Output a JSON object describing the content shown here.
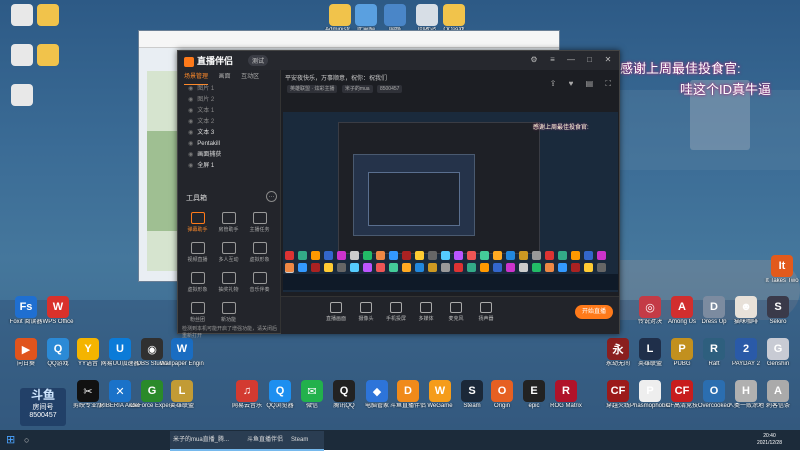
{
  "overlay": {
    "line1": "感谢上周最佳投食官:",
    "line2": "哇这个ID真牛逼"
  },
  "desktop_top_icons": [
    "Administr...",
    "此电脑",
    "网络",
    "回收站",
    "QQ游戏"
  ],
  "desktop_left_icons": [
    {
      "label": "Foxit 阅读器",
      "color": "#1f6fd1",
      "glyph": "Fs"
    },
    {
      "label": "WPS Office",
      "color": "#d9312b",
      "glyph": "W"
    },
    {
      "label": "向日葵",
      "color": "#e0541d",
      "glyph": "▶"
    },
    {
      "label": "QQ游戏",
      "color": "#2b8ad6",
      "glyph": "Q"
    },
    {
      "label": "YY语音",
      "color": "#f4b400",
      "glyph": "Y"
    },
    {
      "label": "网易UU加速器",
      "color": "#0b7bd8",
      "glyph": "U"
    },
    {
      "label": "OBS Studio",
      "color": "#303030",
      "glyph": "◉"
    },
    {
      "label": "Wallpaper Engine",
      "color": "#1a6dc2",
      "glyph": "W"
    }
  ],
  "desktop_bottom_icons": [
    {
      "label": "剪映专业版",
      "color": "#111111",
      "glyph": "✂"
    },
    {
      "label": "RIBERIA Audio",
      "color": "#1a72c9",
      "glyph": "✕"
    },
    {
      "label": "GeForce Experience",
      "color": "#2a8a2a",
      "glyph": "G"
    },
    {
      "label": "英雄联盟",
      "color": "#c29b35",
      "glyph": "L"
    },
    {
      "label": "网易云音乐",
      "color": "#d33a31",
      "glyph": "♫"
    },
    {
      "label": "QQ浏览器",
      "color": "#1d8ff0",
      "glyph": "Q"
    },
    {
      "label": "微信",
      "color": "#22b14c",
      "glyph": "✉"
    },
    {
      "label": "腾讯QQ",
      "color": "#222",
      "glyph": "Q"
    },
    {
      "label": "电脑管家",
      "color": "#2d74d9",
      "glyph": "◆"
    },
    {
      "label": "斗鱼直播伴侣",
      "color": "#f08a1a",
      "glyph": "D"
    },
    {
      "label": "WeGame",
      "color": "#f59c1a",
      "glyph": "W"
    },
    {
      "label": "Steam",
      "color": "#1b2838",
      "glyph": "S"
    },
    {
      "label": "Origin",
      "color": "#e66022",
      "glyph": "O"
    },
    {
      "label": "epic",
      "color": "#222",
      "glyph": "E"
    },
    {
      "label": "ROG Matrix",
      "color": "#b0132a",
      "glyph": "R"
    }
  ],
  "desktop_right_icons": [
    {
      "label": "It Takes Two",
      "color": "#e25a1c",
      "glyph": "It"
    },
    {
      "label": "传说对决",
      "color": "#c43b46",
      "glyph": "◎"
    },
    {
      "label": "Among Us",
      "color": "#d12e2e",
      "glyph": "A"
    },
    {
      "label": "Dress Up",
      "color": "#7c8ba0",
      "glyph": "D"
    },
    {
      "label": "猫咪咖啡",
      "color": "#e8e1d9",
      "glyph": "☻"
    },
    {
      "label": "Sekiro",
      "color": "#3a3a4a",
      "glyph": "S"
    },
    {
      "label": "永劫无间",
      "color": "#8a1f1f",
      "glyph": "永"
    },
    {
      "label": "英雄联盟",
      "color": "#1f2f4a",
      "glyph": "L"
    },
    {
      "label": "PUBG",
      "color": "#c2901e",
      "glyph": "P"
    },
    {
      "label": "Raft",
      "color": "#2e5f7e",
      "glyph": "R"
    },
    {
      "label": "PAYDAY 2",
      "color": "#2a5aa8",
      "glyph": "2"
    },
    {
      "label": "Genshin",
      "color": "#c8cbd4",
      "glyph": "G"
    },
    {
      "label": "穿越火线",
      "color": "#9c1a1a",
      "glyph": "CF"
    },
    {
      "label": "Phasmophobia",
      "color": "#eee",
      "glyph": "P"
    },
    {
      "label": "CF高清竞技",
      "color": "#c81d1d",
      "glyph": "CF"
    },
    {
      "label": "Overcooked",
      "color": "#2b6eb0",
      "glyph": "O"
    },
    {
      "label": "人类一败涂地",
      "color": "#b0b0b0",
      "glyph": "H"
    },
    {
      "label": "刺客信条",
      "color": "#aaaaaa",
      "glyph": "A"
    }
  ],
  "app": {
    "name": "直播伴侣",
    "version": "测试",
    "left_tabs": [
      "场景管理",
      "画面",
      "互动区"
    ],
    "layers": [
      "图片 1",
      "图片 2",
      "文本 1",
      "文本 2",
      "文本 3",
      "Pentakill",
      "画面捕获",
      "全屏 1"
    ],
    "tools_header": "工具箱",
    "tools": [
      "弹幕助手",
      "房管助手",
      "主播任务",
      "视频直播",
      "多人互动",
      "虚拟形象",
      "虚拟形象",
      "抽奖礼物",
      "音乐伴奏",
      "粉丝团",
      "新功能"
    ],
    "notice": "检测到本机可能开启了增强功能，请关闭后重新打开",
    "topbar": "平安夜快乐，万事顺意，祝你：祝我们",
    "room_chip": "英雄联盟 · 炫彩主播",
    "room_name": "米子的mua",
    "room_id": "8500457",
    "share": "进行分享",
    "bottom": [
      "直播画面",
      "摄像头",
      "手机投屏",
      "多媒体",
      "麦克风",
      "扬声器"
    ],
    "golive": "开始直播"
  },
  "taskbar": {
    "tasks": [
      "米子的mua直播_腾...",
      "斗鱼直播伴侣",
      "Steam"
    ],
    "time": "20:40",
    "date": "2021/12/28"
  },
  "watermark": {
    "logo": "斗鱼",
    "label": "房间号",
    "room": "8500457"
  }
}
